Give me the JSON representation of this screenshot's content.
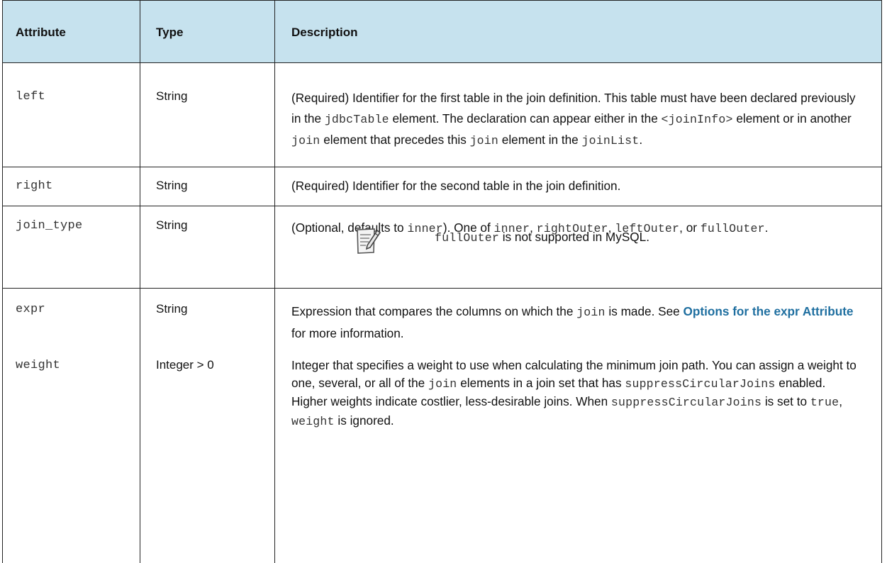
{
  "headers": {
    "attribute": "Attribute",
    "type": "Type",
    "description": "Description"
  },
  "rows": [
    {
      "attr": "left",
      "type": "String",
      "desc": {
        "t1": "(Required) Identifier for the first table in the join definition. This table must have been declared previously in the ",
        "c1": "jdbcTable",
        "t2": " element. The declaration can appear either in the ",
        "c2": "<joinInfo>",
        "t3": " element or in another ",
        "c3": "join",
        "t4": " element that precedes this ",
        "c4": "join",
        "t5": " element in the ",
        "c5": "joinList",
        "t6": "."
      }
    },
    {
      "attr": "right",
      "type": "String",
      "desc": "(Required) Identifier for the second table in the join definition."
    },
    {
      "attr": "join_type",
      "type": "String",
      "desc": {
        "t1": "(Optional, defaults to ",
        "c1": "inner",
        "t2": "). One of ",
        "c2": "inner",
        "t3": ", ",
        "c3": "rightOuter",
        "t4": ", ",
        "c4": "leftOuter",
        "t5": ", or ",
        "c5": "fullOuter",
        "t6": "."
      },
      "note": {
        "code": "fullOuter",
        "text": " is not supported in MySQL.",
        "icon": "note-pencil-icon"
      }
    },
    {
      "attr": "expr",
      "type": "String",
      "desc": {
        "t1": "Expression that compares the columns on which the ",
        "c1": "join",
        "t2": " is made. See ",
        "link": "Options for the expr Attribute",
        "t3": " for more information."
      }
    },
    {
      "attr": "weight",
      "type": "Integer > 0",
      "desc": {
        "t1": "Integer that specifies a weight to use when calculating the minimum join path. You can assign a weight to one, several, or all of the ",
        "c1": "join",
        "t2": " elements in a join set that has ",
        "c2": "suppressCircularJoins",
        "t3": " enabled. Higher weights indicate costlier, less-desirable joins. When ",
        "c3": "suppressCircularJoins",
        "t4": " is set to ",
        "c4": "true",
        "t5": ", ",
        "c5": "weight",
        "t6": " is ignored."
      }
    }
  ],
  "colors": {
    "header_bg": "#c6e2ee",
    "link": "#1f6fa0",
    "border": "#222222"
  }
}
